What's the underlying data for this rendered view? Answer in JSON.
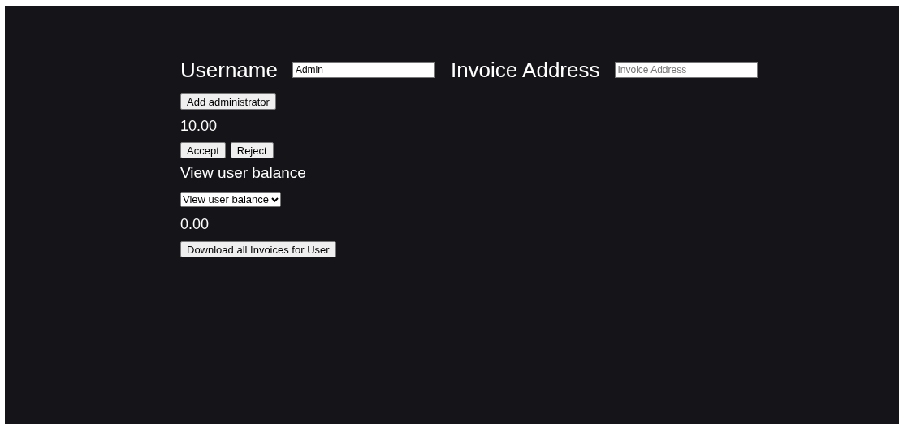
{
  "username": {
    "label": "Username",
    "value": "Admin"
  },
  "invoice_address": {
    "label": "Invoice Address",
    "placeholder": "Invoice Address"
  },
  "add_button": "Add administrator",
  "pending_amount": "10.00",
  "decision_buttons": [
    "Accept",
    "Reject"
  ],
  "balance_heading": "View user balance",
  "balance_select": {
    "value": "View user balance"
  },
  "balance_amount": "0.00",
  "download_button": "Download all Invoices for User"
}
